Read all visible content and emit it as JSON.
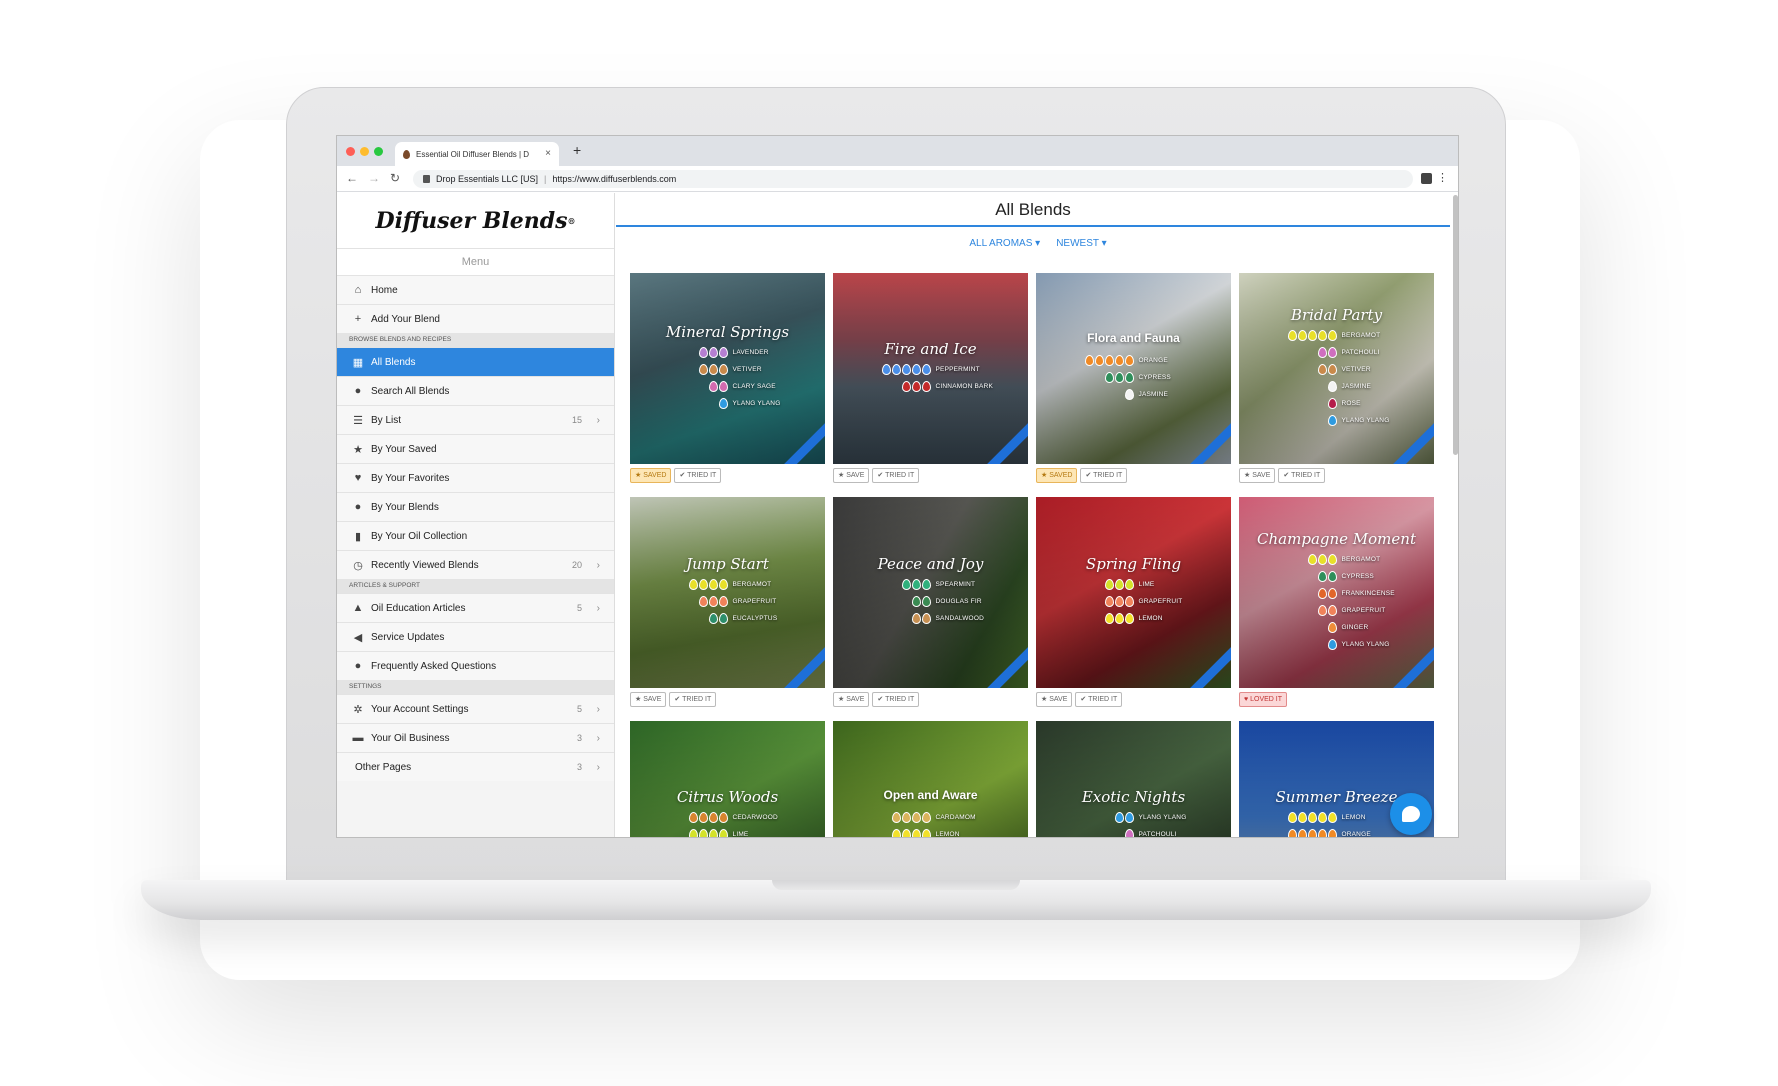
{
  "browser": {
    "tab_title": "Essential Oil Diffuser Blends | D",
    "new_tab": "+",
    "tab_close": "×",
    "site_owner": "Drop Essentials LLC [US]",
    "url": "https://www.diffuserblends.com"
  },
  "sidebar": {
    "logo": "Diffuser Blends",
    "logo_mark": "®",
    "menu_label": "Menu",
    "items": [
      {
        "label": "Home",
        "icon": "home-icon"
      },
      {
        "label": "Add Your Blend",
        "icon": "plus-icon"
      },
      {
        "section": "Browse Blends and Recipes"
      },
      {
        "label": "All Blends",
        "icon": "grid-icon",
        "active": true
      },
      {
        "label": "Search All Blends",
        "icon": "search-bubble-icon"
      },
      {
        "label": "By List",
        "icon": "list-icon",
        "count": "15"
      },
      {
        "label": "By Your Saved",
        "icon": "star-icon"
      },
      {
        "label": "By Your Favorites",
        "icon": "heart-icon"
      },
      {
        "label": "By Your Blends",
        "icon": "user-icon"
      },
      {
        "label": "By Your Oil Collection",
        "icon": "bottle-icon"
      },
      {
        "label": "Recently Viewed Blends",
        "icon": "history-icon",
        "count": "20"
      },
      {
        "section": "Articles & Support"
      },
      {
        "label": "Oil Education Articles",
        "icon": "graduation-cap-icon",
        "count": "5"
      },
      {
        "label": "Service Updates",
        "icon": "megaphone-icon"
      },
      {
        "label": "Frequently Asked Questions",
        "icon": "question-bubble-icon"
      },
      {
        "section": "Settings"
      },
      {
        "label": "Your Account Settings",
        "icon": "gear-icon",
        "count": "5"
      },
      {
        "label": "Your Oil Business",
        "icon": "briefcase-icon",
        "count": "3"
      },
      {
        "label": "Other Pages",
        "count": "3"
      }
    ]
  },
  "main": {
    "title": "All Blends",
    "filter_aromas": "ALL AROMAS",
    "filter_sort": "NEWEST",
    "save": "SAVE",
    "saved": "SAVED",
    "tried": "TRIED IT",
    "loved": "LOVED IT"
  },
  "colors": {
    "accent": "#2e86de",
    "lavender": "#b47fd1",
    "vetiver": "#c98a4b",
    "clary_sage": "#d36bb0",
    "ylang": "#2f9be0",
    "peppermint": "#4a8ee8",
    "cinnamon": "#c42a2a",
    "orange": "#f08a26",
    "cypress": "#2f8f5b",
    "jasmine": "#f3f3f3",
    "bergamot": "#e8e02a",
    "patchouli": "#cf6fbf",
    "rose": "#b51d4a",
    "grapefruit": "#f0825a",
    "eucalyptus": "#2e8f6c",
    "spearmint": "#2fb07c",
    "douglas_fir": "#3a8a52",
    "sandalwood": "#c79153",
    "lime": "#d4e22a",
    "lemon": "#f2e12a",
    "frankincense": "#e2662a",
    "ginger": "#ee8d3a",
    "cedarwood": "#d8852e",
    "cardamom": "#d9b35b"
  },
  "blends": [
    {
      "title": "Mineral Springs",
      "bg": "linear-gradient(160deg,#5f7d86 0%,#3d5a63 40%,#2a8a8a 70%,#1c5f6a 100%)",
      "oils": [
        {
          "name": "Lavender",
          "drops": 3,
          "color": "#b47fd1"
        },
        {
          "name": "Vetiver",
          "drops": 3,
          "color": "#c98a4b"
        },
        {
          "name": "Clary Sage",
          "drops": 2,
          "color": "#d36bb0"
        },
        {
          "name": "Ylang Ylang",
          "drops": 1,
          "color": "#2f9be0"
        }
      ],
      "status": "saved",
      "tried": true
    },
    {
      "title": "Fire and Ice",
      "bg": "linear-gradient(180deg,#c4484d 0%,#8a4a55 35%,#54636f 60%,#3b4a55 100%)",
      "oils": [
        {
          "name": "Peppermint",
          "drops": 5,
          "color": "#4a8ee8"
        },
        {
          "name": "Cinnamon Bark",
          "drops": 3,
          "color": "#c42a2a"
        }
      ],
      "status": "save",
      "tried": true
    },
    {
      "title": "Flora and Fauna",
      "plain": true,
      "bg": "linear-gradient(150deg,#8aa1ba 0%,#dfe3e6 40%,#6b7c4a 75%,#aeb9c5 100%)",
      "oils": [
        {
          "name": "Orange",
          "drops": 5,
          "color": "#f08a26"
        },
        {
          "name": "Cypress",
          "drops": 3,
          "color": "#2f8f5b"
        },
        {
          "name": "Jasmine",
          "drops": 1,
          "color": "#f3f3f3"
        }
      ],
      "status": "saved",
      "tried": true
    },
    {
      "title": "Bridal Party",
      "bg": "linear-gradient(140deg,#d9dcc8 0%,#9ba878 40%,#e6e3d5 70%,#6d7a52 100%)",
      "oils": [
        {
          "name": "Bergamot",
          "drops": 5,
          "color": "#e8e02a"
        },
        {
          "name": "Patchouli",
          "drops": 2,
          "color": "#cf6fbf"
        },
        {
          "name": "Vetiver",
          "drops": 2,
          "color": "#c98a4b"
        },
        {
          "name": "Jasmine",
          "drops": 1,
          "color": "#f3f3f3"
        },
        {
          "name": "Rose",
          "drops": 1,
          "color": "#b51d4a"
        },
        {
          "name": "Ylang Ylang",
          "drops": 1,
          "color": "#2f9be0"
        }
      ],
      "status": "save",
      "tried": true
    },
    {
      "title": "Jump Start",
      "bg": "linear-gradient(170deg,#c9cfc0 0%,#7c9a4e 40%,#5d7b33 70%,#8a9a5a 100%)",
      "oils": [
        {
          "name": "Bergamot",
          "drops": 4,
          "color": "#e8e02a"
        },
        {
          "name": "Grapefruit",
          "drops": 3,
          "color": "#f0825a"
        },
        {
          "name": "Eucalyptus",
          "drops": 2,
          "color": "#2e8f6c"
        }
      ],
      "status": "save",
      "tried": true
    },
    {
      "title": "Peace and Joy",
      "bg": "linear-gradient(120deg,#3d3d3d 0%,#5a5a55 45%,#2f4d25 75%,#4f7a2e 100%)",
      "oils": [
        {
          "name": "Spearmint",
          "drops": 3,
          "color": "#2fb07c"
        },
        {
          "name": "Douglas Fir",
          "drops": 2,
          "color": "#3a8a52"
        },
        {
          "name": "Sandalwood",
          "drops": 2,
          "color": "#c79153"
        }
      ],
      "status": "save",
      "tried": true
    },
    {
      "title": "Spring Fling",
      "bg": "linear-gradient(150deg,#b21e27 0%,#d8383c 40%,#7a1a1f 70%,#3d6a2a 100%)",
      "oils": [
        {
          "name": "Lime",
          "drops": 3,
          "color": "#d4e22a"
        },
        {
          "name": "Grapefruit",
          "drops": 3,
          "color": "#f0825a"
        },
        {
          "name": "Lemon",
          "drops": 3,
          "color": "#f2e12a"
        }
      ],
      "status": "save",
      "tried": true
    },
    {
      "title": "Champagne Moment",
      "bg": "linear-gradient(150deg,#d9607a 0%,#e4a0ad 40%,#b84358 70%,#6f7e55 100%)",
      "oils": [
        {
          "name": "Bergamot",
          "drops": 3,
          "color": "#e8e02a"
        },
        {
          "name": "Cypress",
          "drops": 2,
          "color": "#2f8f5b"
        },
        {
          "name": "Frankincense",
          "drops": 2,
          "color": "#e2662a"
        },
        {
          "name": "Grapefruit",
          "drops": 2,
          "color": "#f0825a"
        },
        {
          "name": "Ginger",
          "drops": 1,
          "color": "#ee8d3a"
        },
        {
          "name": "Ylang Ylang",
          "drops": 1,
          "color": "#2f9be0"
        }
      ],
      "status": "loved",
      "tried": false
    },
    {
      "title": "Citrus Woods",
      "bg": "linear-gradient(150deg,#2f6a28 0%,#5d9a3c 45%,#244d1e 100%)",
      "oils": [
        {
          "name": "Cedarwood",
          "drops": 4,
          "color": "#d8852e"
        },
        {
          "name": "Lime",
          "drops": 4,
          "color": "#d4e22a"
        }
      ]
    },
    {
      "title": "Open and Aware",
      "plain": true,
      "bg": "linear-gradient(150deg,#3f6a1e 0%,#86b23a 50%,#2e4f18 100%)",
      "oils": [
        {
          "name": "Cardamom",
          "drops": 4,
          "color": "#d9b35b"
        },
        {
          "name": "Lemon",
          "drops": 4,
          "color": "#f2e12a"
        }
      ]
    },
    {
      "title": "Exotic Nights",
      "bg": "linear-gradient(150deg,#2b3a2b 0%,#4b6a44 45%,#1e2b1e 100%)",
      "oils": [
        {
          "name": "Ylang Ylang",
          "drops": 2,
          "color": "#2f9be0"
        },
        {
          "name": "Patchouli",
          "drops": 1,
          "color": "#cf6fbf"
        }
      ]
    },
    {
      "title": "Summer Breeze",
      "bg": "linear-gradient(180deg,#1a4aa8 0%,#3c7ad0 50%,#a6b8c8 100%)",
      "oils": [
        {
          "name": "Lemon",
          "drops": 5,
          "color": "#f2e12a"
        },
        {
          "name": "Orange",
          "drops": 5,
          "color": "#f08a26"
        }
      ]
    }
  ]
}
